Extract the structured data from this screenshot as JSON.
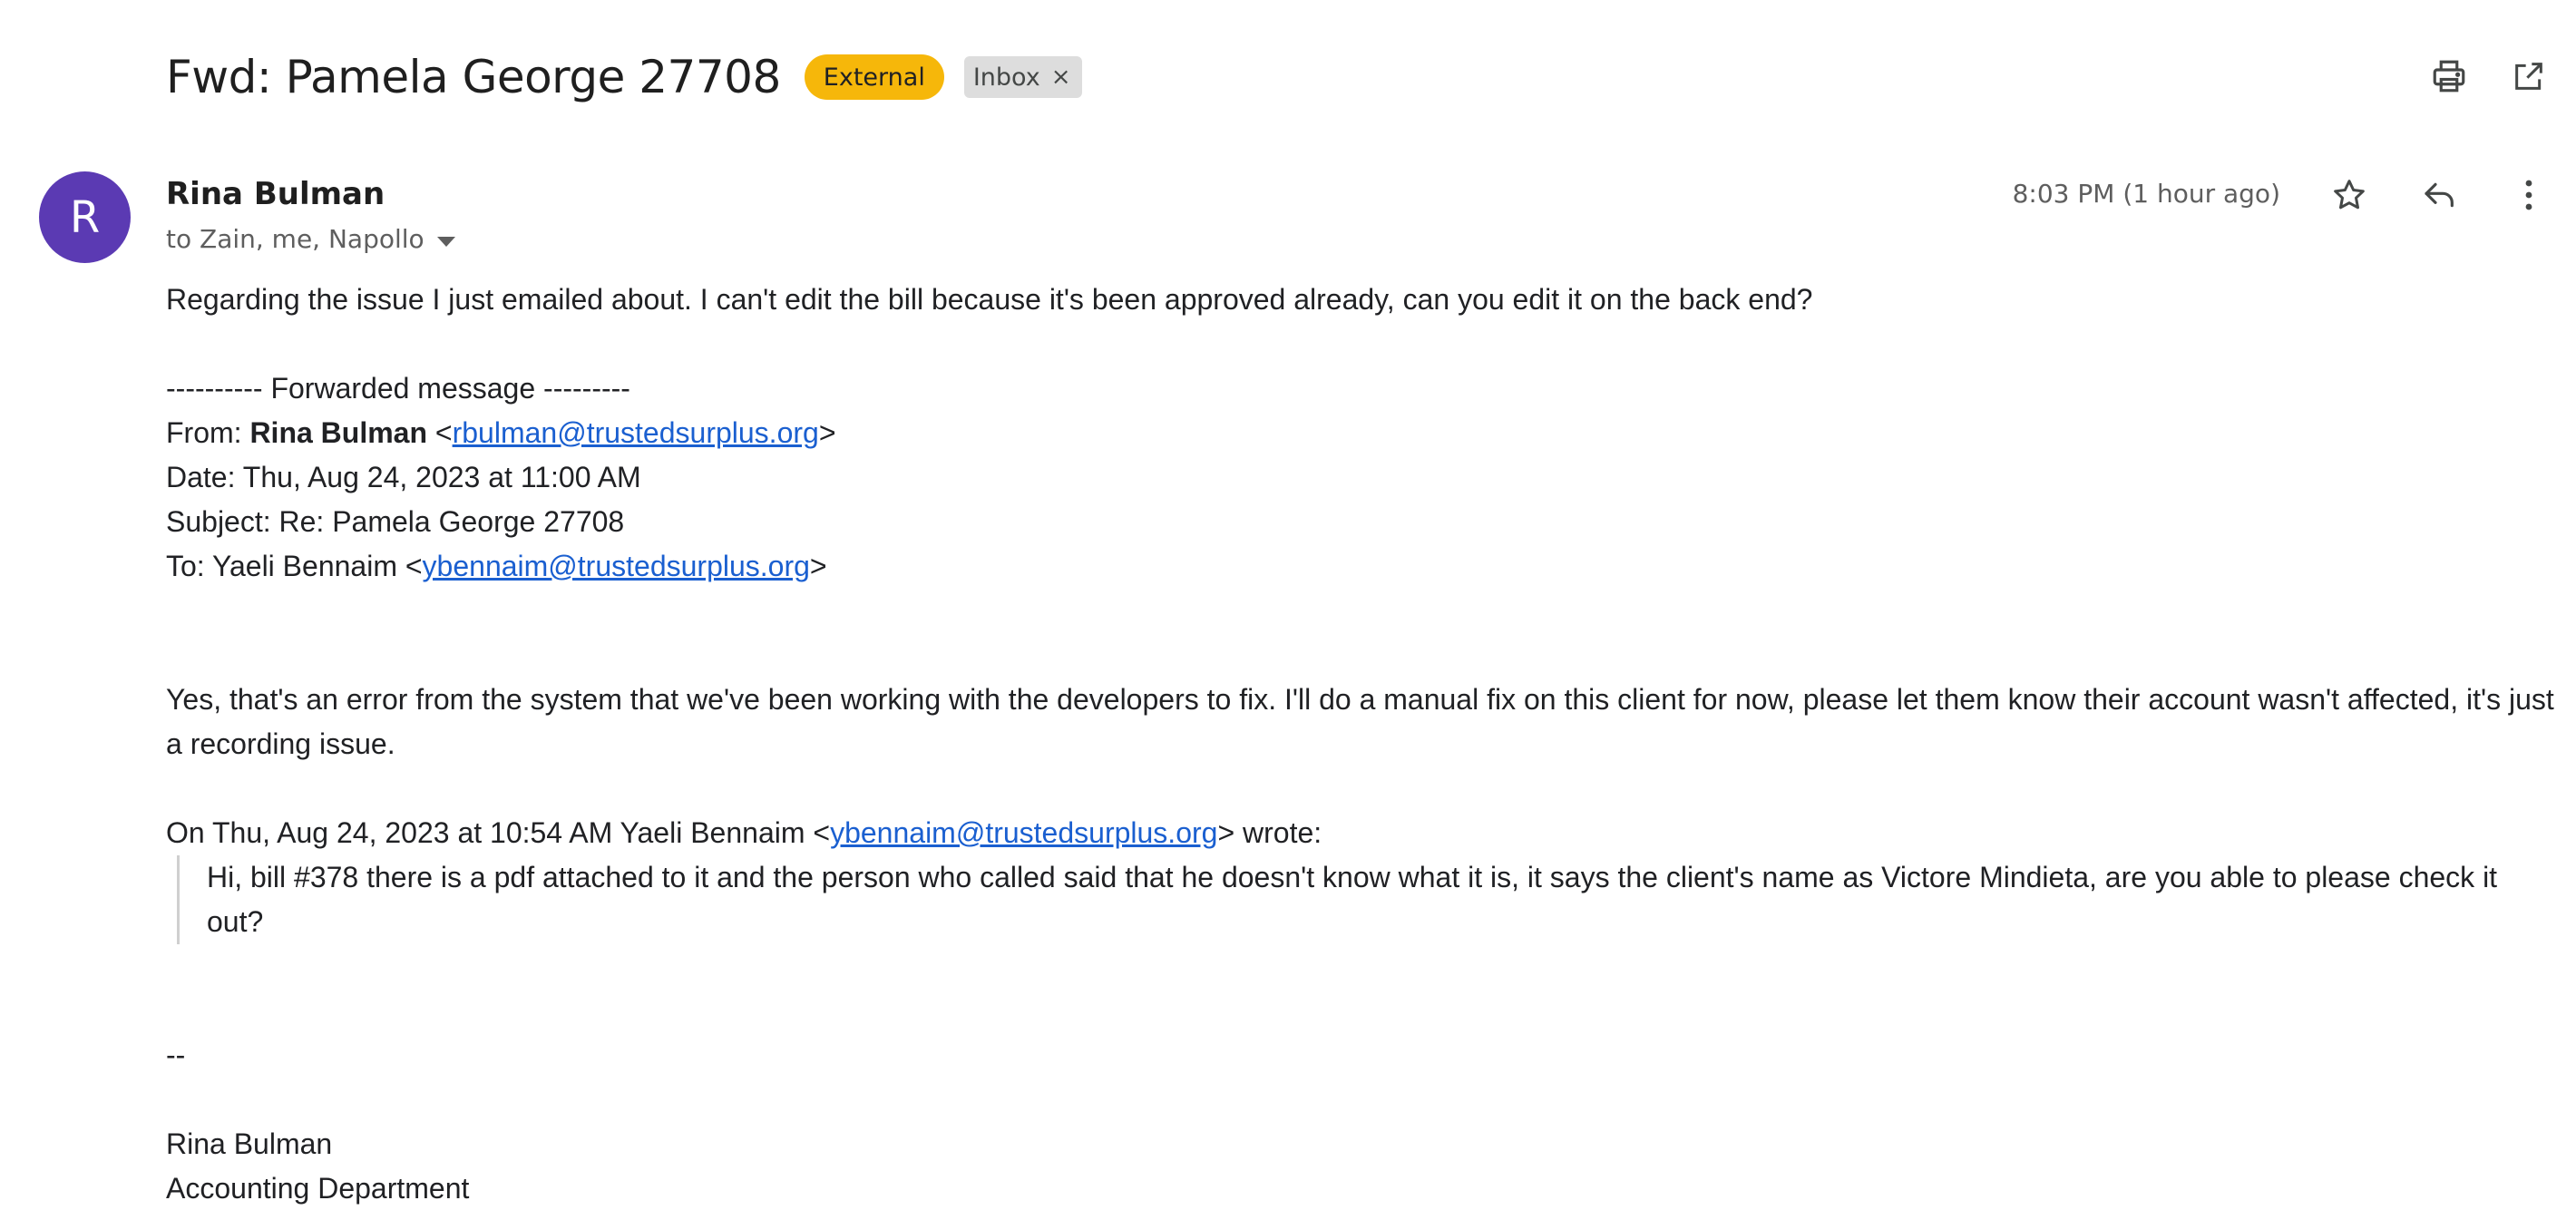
{
  "email": {
    "subject": "Fwd: Pamela George 27708",
    "badge_external": "External",
    "label": "Inbox",
    "label_remove": "×",
    "sender": {
      "initial": "R",
      "name": "Rina Bulman",
      "recipients": "to Zain, me, Napollo"
    },
    "timestamp": "8:03 PM (1 hour ago)",
    "body": {
      "intro": "Regarding the issue I just emailed about.  I can't edit the bill because it's been approved already, can you edit it on the back end?",
      "fwd_header": "---------- Forwarded message ---------",
      "from_label": "From: ",
      "from_name": "Rina Bulman",
      "from_email": "rbulman@trustedsurplus.org",
      "date": "Date: Thu, Aug 24, 2023 at 11:00 AM",
      "subject_line": "Subject: Re: Pamela George 27708",
      "to_label": "To: Yaeli Bennaim <",
      "to_email": "ybennaim@trustedsurplus.org",
      "reply": "Yes, that's an error from the system that we've been working with the developers to fix.  I'll do a manual fix on this client for now, please let them know their account wasn't affected, it's just a recording issue.",
      "quote_attribution": "On Thu, Aug 24, 2023 at 10:54 AM Yaeli Bennaim <",
      "quote_email": "ybennaim@trustedsurplus.org",
      "quote_wrote": "> wrote:",
      "quote_text": "Hi, bill #378 there is a pdf attached to it and the person who called said that he doesn't know what it is, it says the client's name as Victore Mindieta, are you able to please check it out?",
      "sig_sep": "--",
      "sig_name": "Rina Bulman",
      "sig_dept": "Accounting Department"
    }
  },
  "icons": [
    "print-icon",
    "open-in-new-icon",
    "star-icon",
    "reply-icon",
    "more-vert-icon",
    "dropdown-arrow-icon"
  ],
  "colors": {
    "external_badge": "#f6b70a",
    "avatar": "#5b3ab3",
    "link": "#1a5fd0"
  }
}
